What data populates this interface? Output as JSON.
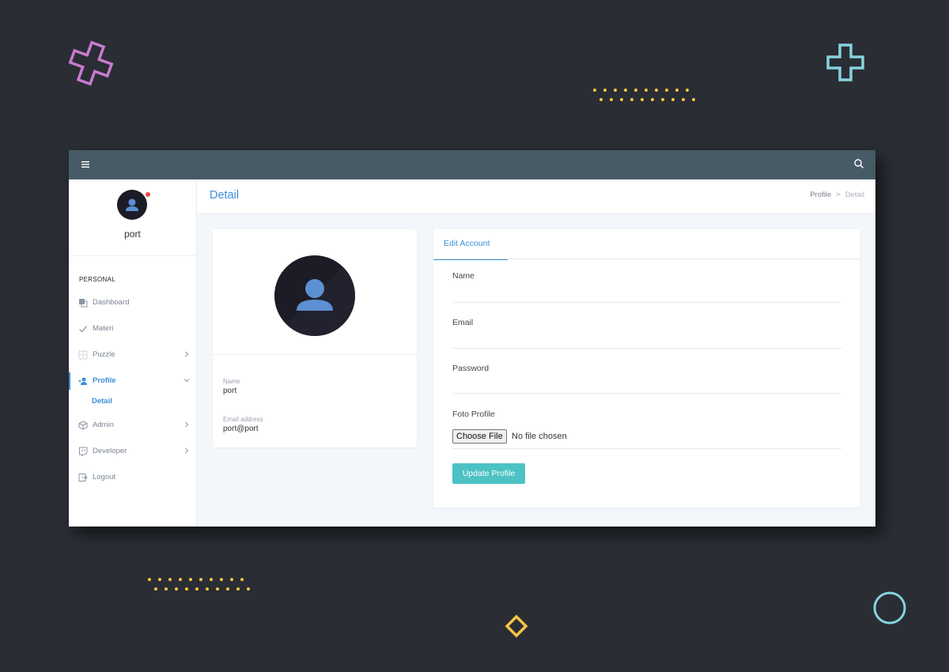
{
  "app": {
    "topbar": {
      "menu_icon": "hamburger-icon",
      "search_icon": "search-icon",
      "color": "#465b66"
    },
    "accent": "#3b8fd8",
    "button_color": "#4cc2c4"
  },
  "sidebar": {
    "username": "port",
    "status_dot_color": "#ef4747",
    "section_label": "PERSONAL",
    "items": [
      {
        "label": "Dashboard",
        "icon": "dashboard-icon",
        "expandable": false
      },
      {
        "label": "Materi",
        "icon": "check-icon",
        "expandable": false
      },
      {
        "label": "Puzzle",
        "icon": "grid-icon",
        "expandable": true
      },
      {
        "label": "Profile",
        "icon": "user-plus-icon",
        "expandable": true,
        "active": true
      },
      {
        "label": "Admin",
        "icon": "box-icon",
        "expandable": true
      },
      {
        "label": "Developer",
        "icon": "twitch-icon",
        "expandable": true
      },
      {
        "label": "Logout",
        "icon": "logout-icon",
        "expandable": false
      }
    ],
    "subitem": "Detail"
  },
  "header": {
    "title": "Detail",
    "breadcrumb": [
      "Profile",
      "Detail"
    ]
  },
  "profile_card": {
    "name_label": "Name",
    "name_value": "port",
    "email_label": "Email address",
    "email_value": "port@port"
  },
  "edit_form": {
    "tab": "Edit Account",
    "fields": [
      {
        "label": "Name",
        "value": ""
      },
      {
        "label": "Email",
        "value": ""
      },
      {
        "label": "Password",
        "value": ""
      }
    ],
    "photo_label": "Foto Profile",
    "file_button": "Choose File",
    "file_status": "No file chosen",
    "submit": "Update Profile"
  }
}
